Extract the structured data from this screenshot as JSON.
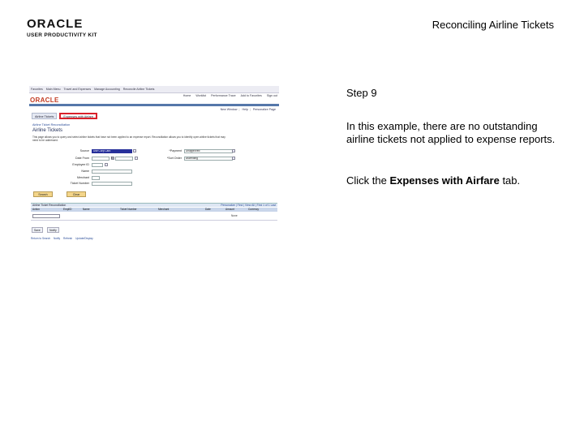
{
  "header": {
    "logo_word": "ORACLE",
    "logo_sub": "USER PRODUCTIVITY KIT",
    "title": "Reconciling Airline Tickets"
  },
  "instructions": {
    "step": "Step 9",
    "paragraph": "In this example, there are no outstanding airline tickets not applied to expense reports.",
    "action_prefix": "Click the ",
    "action_target": "Expenses with Airfare",
    "action_suffix": " tab."
  },
  "screenshot": {
    "breadcrumbs": [
      "Favorites",
      "Main Menu",
      "Travel and Expenses",
      "Manage Accounting",
      "Reconcile Airline Tickets"
    ],
    "brand": "ORACLE",
    "nav_links": [
      "Home",
      "Worklist",
      "Performance Trace",
      "Add to Favorites",
      "Sign out"
    ],
    "window_links": [
      "New Window",
      "Help",
      "Personalize Page"
    ],
    "tabs": {
      "airline_tickets": "Airline Tickets",
      "expenses_with_airfare": "Expenses with Airfare"
    },
    "section_link": "Airline Ticket Reconciliation",
    "page_title": "Airline Tickets",
    "description": "This page allows you to query and select airline tickets that have not been applied to an expense report. Reconciliation allows you to identify open airline tickets that may need to be addressed.",
    "fields": {
      "source_label": "Source",
      "source_value": "Use Corp Card",
      "date_from_label": "Date From",
      "to_label": "To",
      "employee_id_label": "Employee ID",
      "name_label": "Name",
      "merchant_label": "Merchant",
      "ticket_number_label": "Ticket Number",
      "payment_label": "*Payment",
      "payment_value": "Unapproved",
      "sort_order_label": "*Sort Order",
      "sort_order_value": "Ascending"
    },
    "buttons": {
      "search": "Search",
      "clear": "Clear",
      "save": "Save",
      "notify": "Notify"
    },
    "grid": {
      "title": "Airline Ticket Reconciliation",
      "nav": "Personalize | Find | View All | First 1 of 1 Last",
      "columns": [
        "Action",
        "EmplID",
        "Name",
        "Ticket Number",
        "Merchant",
        "Date",
        "Amount",
        "Currency"
      ],
      "empty_text": "None"
    },
    "footer_links": [
      "Return to Search",
      "Notify",
      "Refresh",
      "Update/Display"
    ]
  }
}
